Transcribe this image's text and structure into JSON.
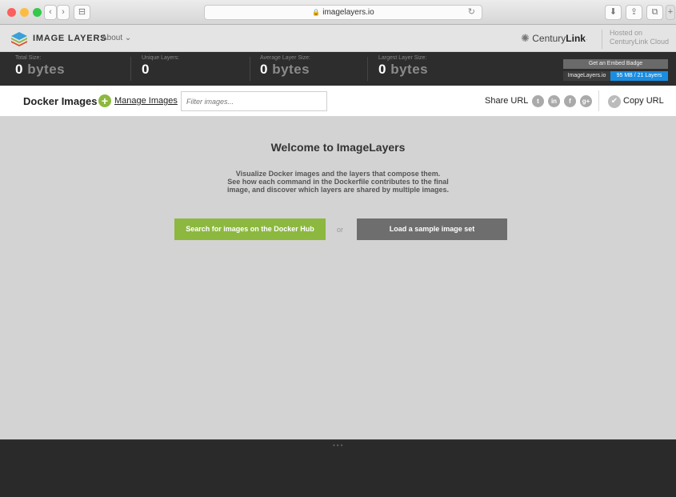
{
  "browser": {
    "url": "imagelayers.io",
    "traffic_colors": [
      "#fc605c",
      "#fdbc40",
      "#34c84a"
    ],
    "back_glyph": "‹",
    "fwd_glyph": "›",
    "sidebar_glyph": "⊟",
    "reload_glyph": "↻",
    "download_glyph": "⬇",
    "share_glyph": "⇪",
    "tabs_glyph": "⧉",
    "newtab_glyph": "+"
  },
  "header": {
    "brand": "IMAGE LAYERS",
    "about": "About ⌄",
    "ctl_prefix": "Century",
    "ctl_bold": "Link",
    "ctl_mark": "·",
    "hosted_line1": "Hosted on",
    "hosted_line2": "CenturyLink Cloud"
  },
  "stats": [
    {
      "label": "Total Size:",
      "num": "0",
      "unit": " bytes"
    },
    {
      "label": "Unique Layers:",
      "num": "0",
      "unit": ""
    },
    {
      "label": "Average Layer Size:",
      "num": "0",
      "unit": " bytes"
    },
    {
      "label": "Largest Layer Size:",
      "num": "0",
      "unit": " bytes"
    }
  ],
  "badge": {
    "embed": "Get an Embed Badge",
    "left": "ImageLayers.io",
    "right": "95 MB / 21 Layers"
  },
  "toolbar": {
    "title": "Docker Images",
    "manage": "Manage Images",
    "filter_placeholder": "Filter images...",
    "share": "Share URL",
    "copy": "Copy URL",
    "social": [
      "t",
      "in",
      "f",
      "g+"
    ]
  },
  "main": {
    "welcome": "Welcome to ImageLayers",
    "desc1": "Visualize Docker images and the layers that compose them.",
    "desc2": "See how each command in the Dockerfile contributes to the final",
    "desc3": "image, and discover which layers are shared by multiple images.",
    "search_btn": "Search for images on the Docker Hub",
    "or": "or",
    "sample_btn": "Load a sample image set"
  },
  "footer": {
    "dots": "•••"
  },
  "colors": {
    "accent_green": "#8cb83f",
    "badge_blue": "#1a8de0"
  }
}
